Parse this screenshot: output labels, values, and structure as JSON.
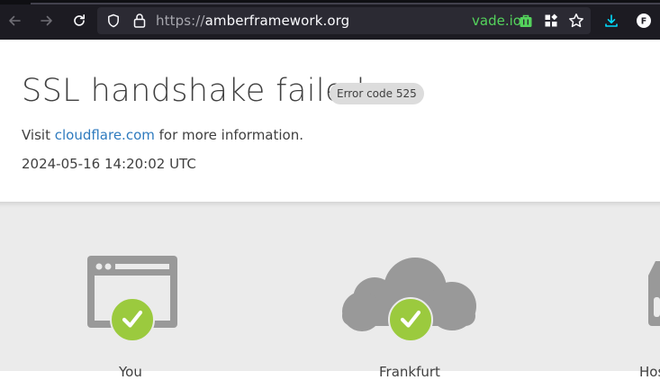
{
  "browser": {
    "url_protocol": "https://",
    "url_host": "amberframework.org",
    "vpn_extension_label": "vade.io",
    "profile_initial": "F",
    "icons": {
      "back": "arrow-left-icon",
      "forward": "arrow-right-icon",
      "reload": "reload-icon",
      "tracking_protection": "shield-icon",
      "site_security": "lock-icon",
      "vpn": "shopping-bag-icon",
      "extensions": "extensions-grid-icon",
      "bookmark": "star-icon",
      "downloads": "download-icon"
    },
    "colors": {
      "chrome_bg": "#1c1b22",
      "urlbar_bg": "#2b2a33",
      "vpn_green": "#54d35c",
      "download_blue": "#00ddff"
    }
  },
  "page": {
    "title": "SSL handshake failed",
    "error_badge": "Error code 525",
    "visit_prefix": "Visit ",
    "visit_link": "cloudflare.com",
    "visit_suffix": " for more information.",
    "timestamp": "2024-05-16 14:20:02 UTC",
    "diagram": {
      "browser_label": "You",
      "cloudflare_label": "Frankfurt",
      "host_label": "Host",
      "browser_status_icon": "check-icon",
      "cloudflare_status_icon": "check-icon",
      "status_ok_color": "#9bca3e",
      "icon_gray": "#999999"
    }
  }
}
